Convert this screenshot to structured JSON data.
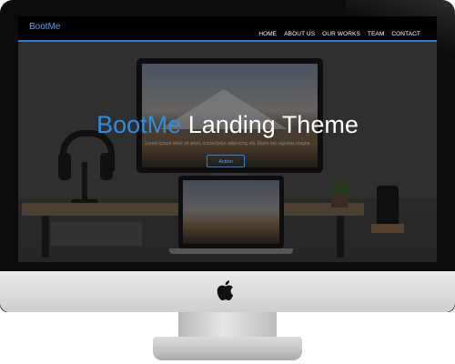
{
  "navbar": {
    "brand": "BootMe",
    "items": [
      "HOME",
      "ABOUT US",
      "OUR WORKS",
      "TEAM",
      "CONTACT"
    ]
  },
  "hero": {
    "title_accent": "BootMe",
    "title_rest": " Landing Theme",
    "subtitle": "Lorem ipsum dolor sit amet, consectetur adipiscing elit. Etiam nec egestas magna",
    "button_label": "Action"
  },
  "colors": {
    "accent": "#2f8de0",
    "navbar_bg": "#000000",
    "monitor_bezel": "#0b0b0b",
    "monitor_chin": "#d9d9d9"
  },
  "icons": {
    "logo": "apple-icon"
  }
}
